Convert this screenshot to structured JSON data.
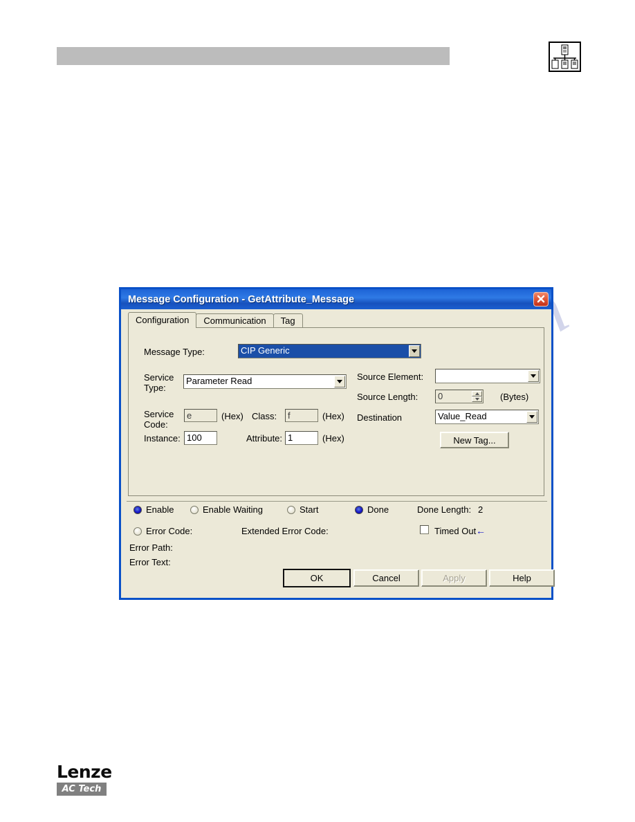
{
  "page": {
    "header_bar_color": "#bcbcbc",
    "network_icon": "network-topology-icon",
    "watermark": "manualshive.com"
  },
  "logo": {
    "brand": "Lenze",
    "sub_brand": "AC Tech"
  },
  "dialog": {
    "title": "Message Configuration - GetAttribute_Message",
    "title_bar_color": "#1d63d6",
    "close_icon": "close-icon",
    "tabs": [
      {
        "label": "Configuration",
        "active": true
      },
      {
        "label": "Communication",
        "active": false
      },
      {
        "label": "Tag",
        "active": false
      }
    ],
    "fields": {
      "message_type_label": "Message Type:",
      "message_type_value": "CIP Generic",
      "service_type_label": "Service\nType:",
      "service_type_label_line1": "Service",
      "service_type_label_line2": "Type:",
      "service_type_value": "Parameter Read",
      "service_code_label_line1": "Service",
      "service_code_label_line2": "Code:",
      "service_code_value": "e",
      "service_code_unit": "(Hex)",
      "class_label": "Class:",
      "class_value": "f",
      "class_unit": "(Hex)",
      "instance_label": "Instance:",
      "instance_value": "100",
      "attribute_label": "Attribute:",
      "attribute_value": "1",
      "attribute_unit": "(Hex)",
      "source_element_label": "Source Element:",
      "source_element_value": "",
      "source_length_label": "Source Length:",
      "source_length_value": "0",
      "source_length_unit": "(Bytes)",
      "destination_label": "Destination",
      "destination_value": "Value_Read",
      "new_tag_button": "New Tag..."
    },
    "status": {
      "enable_label": "Enable",
      "enable_on": true,
      "enable_waiting_label": "Enable Waiting",
      "enable_waiting_on": false,
      "start_label": "Start",
      "start_on": false,
      "done_label": "Done",
      "done_on": true,
      "done_length_label": "Done Length:",
      "done_length_value": "2",
      "error_code_label": "Error Code:",
      "error_code_on": false,
      "extended_error_code_label": "Extended Error Code:",
      "error_path_label": "Error Path:",
      "error_text_label": "Error Text:",
      "timed_out_label": "Timed Out",
      "timed_out_checked": false,
      "timed_out_arrow": "arrow-left-icon"
    },
    "buttons": {
      "ok": "OK",
      "cancel": "Cancel",
      "apply": "Apply",
      "help": "Help"
    }
  }
}
